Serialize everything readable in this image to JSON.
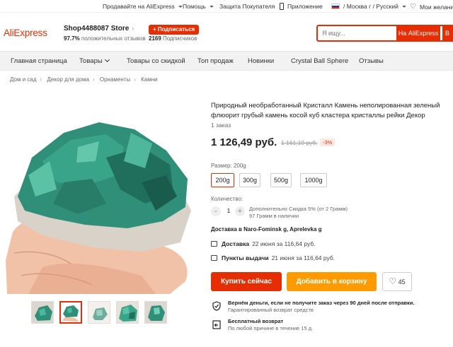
{
  "topbar": {
    "seller": "Продавайте на AliExpress",
    "help": "Помощь",
    "protection": "Защита Покупателя",
    "app": "Приложение",
    "region": "/ Москва г / Русский",
    "wishlist": "Мои желания"
  },
  "header": {
    "logo": "AliExpress",
    "store_name": "Shop4488087 Store",
    "rating_value": "97.7%",
    "rating_label": "положительных отзывов",
    "subscribe": "+ Подписаться",
    "subs_count": "2169",
    "subs_label": "Подписчиков",
    "search_placeholder": "Я ищу...",
    "search_button": "На AliExpress",
    "search_button2": "В"
  },
  "nav": {
    "items": [
      {
        "label": "Главная страница"
      },
      {
        "label": "Товары"
      },
      {
        "label": "Товары со скидкой"
      },
      {
        "label": "Топ продаж"
      },
      {
        "label": "Новинки"
      },
      {
        "label": "Crystal Ball Sphere"
      },
      {
        "label": "Отзывы"
      }
    ]
  },
  "breadcrumb": [
    "Дом и сад",
    "Декор для дома",
    "Орнаменты",
    "Камни"
  ],
  "product": {
    "title": "Природный необработанный Кристалл Камень неполированная зеленый флюорит грубый камень косой куб кластера кристаллы рейки Декор",
    "orders": "1 заказ",
    "price": "1 126,49 руб.",
    "old_price": "1 161,19 руб.",
    "discount": "-3%",
    "size_label": "Размер:",
    "size_selected": "200g",
    "sizes": [
      "200g",
      "300g",
      "500g",
      "1000g"
    ],
    "qty_label": "Количество:",
    "qty_value": "1",
    "qty_minus": "-",
    "qty_plus": "+",
    "qty_discount": "Дополнительно Скидка 5% (от 2 Грамм)",
    "qty_stock": "97 Грамм в наличии",
    "ship_to": "Доставка в Naro-Fominsk g, Aprelevka g",
    "delivery_title": "Доставка",
    "delivery_text": "22 июня за 116,64 руб.",
    "pickup_title": "Пункты выдачи",
    "pickup_text": "21 июня за 116,64 руб.",
    "buy_now": "Купить сейчас",
    "add_cart": "Добавить в корзину",
    "wish_count": "45",
    "guarantee1_title": "Вернём деньги, если не получите заказ через 90 дней после отправки.",
    "guarantee1_sub": "Гарантированный возврат средств",
    "guarantee2_title": "Бесплатный возврат",
    "guarantee2_sub": "По любой причине в течение 15 д."
  },
  "colors": {
    "accent": "#e62e04",
    "cart": "#ff9a00",
    "mineral": "#2f8f78"
  }
}
